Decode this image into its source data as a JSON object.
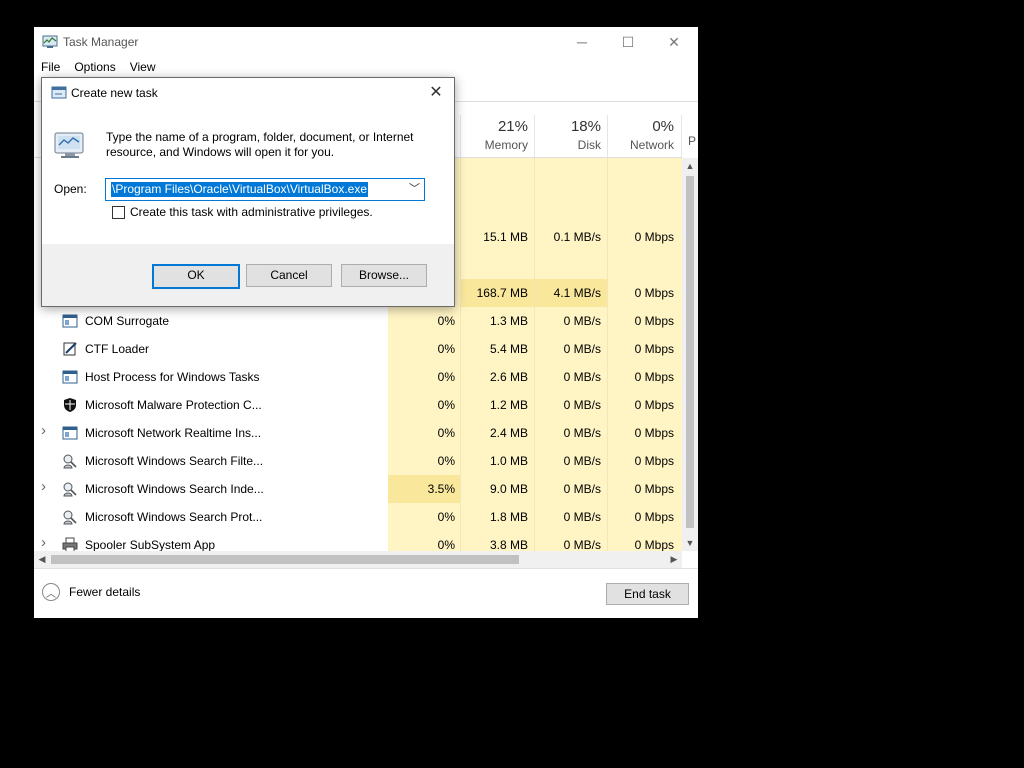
{
  "window": {
    "title": "Task Manager",
    "controls": {
      "minimize": "─",
      "maximize": "☐",
      "close": "✕"
    }
  },
  "menu": [
    "File",
    "Options",
    "View"
  ],
  "columns": [
    {
      "pct": "21%",
      "label": "Memory"
    },
    {
      "pct": "18%",
      "label": "Disk"
    },
    {
      "pct": "0%",
      "label": "Network"
    }
  ],
  "partial_header": {
    "p": "P"
  },
  "processes": [
    {
      "expand": "",
      "icon": "none",
      "name": "",
      "cpu": "",
      "mem": "",
      "disk": "",
      "net": ""
    },
    {
      "expand": "",
      "icon": "none",
      "name": "",
      "cpu": "",
      "mem": "15.1 MB",
      "disk": "0.1 MB/s",
      "net": "0 Mbps"
    },
    {
      "expand": "",
      "icon": "none",
      "name": "",
      "cpu": "",
      "mem": "",
      "disk": "",
      "net": ""
    },
    {
      "expand": "",
      "icon": "none",
      "name": "",
      "cpu": "",
      "mem": "168.7 MB",
      "disk": "4.1 MB/s",
      "net": "0 Mbps"
    },
    {
      "expand": "",
      "icon": "app-window-icon",
      "name": "COM Surrogate",
      "cpu": "0%",
      "mem": "1.3 MB",
      "disk": "0 MB/s",
      "net": "0 Mbps"
    },
    {
      "expand": "",
      "icon": "ctf-loader-icon",
      "name": "CTF Loader",
      "cpu": "0%",
      "mem": "5.4 MB",
      "disk": "0 MB/s",
      "net": "0 Mbps"
    },
    {
      "expand": "",
      "icon": "app-window-icon",
      "name": "Host Process for Windows Tasks",
      "cpu": "0%",
      "mem": "2.6 MB",
      "disk": "0 MB/s",
      "net": "0 Mbps"
    },
    {
      "expand": "",
      "icon": "shield-icon",
      "name": "Microsoft Malware Protection C...",
      "cpu": "0%",
      "mem": "1.2 MB",
      "disk": "0 MB/s",
      "net": "0 Mbps"
    },
    {
      "expand": ">",
      "icon": "app-window-icon",
      "name": "Microsoft Network Realtime Ins...",
      "cpu": "0%",
      "mem": "2.4 MB",
      "disk": "0 MB/s",
      "net": "0 Mbps"
    },
    {
      "expand": "",
      "icon": "search-person-icon",
      "name": "Microsoft Windows Search Filte...",
      "cpu": "0%",
      "mem": "1.0 MB",
      "disk": "0 MB/s",
      "net": "0 Mbps"
    },
    {
      "expand": ">",
      "icon": "search-person-icon",
      "name": "Microsoft Windows Search Inde...",
      "cpu": "3.5%",
      "mem": "9.0 MB",
      "disk": "0 MB/s",
      "net": "0 Mbps"
    },
    {
      "expand": "",
      "icon": "search-person-icon",
      "name": "Microsoft Windows Search Prot...",
      "cpu": "0%",
      "mem": "1.8 MB",
      "disk": "0 MB/s",
      "net": "0 Mbps"
    },
    {
      "expand": ">",
      "icon": "printer-icon",
      "name": "Spooler SubSystem App",
      "cpu": "0%",
      "mem": "3.8 MB",
      "disk": "0 MB/s",
      "net": "0 Mbps"
    }
  ],
  "footer": {
    "fewer_details": "Fewer details",
    "end_task": "End task"
  },
  "dialog": {
    "title": "Create new task",
    "message": "Type the name of a program, folder, document, or Internet resource, and Windows will open it for you.",
    "open_label": "Open:",
    "open_value": "\\Program Files\\Oracle\\VirtualBox\\VirtualBox.exe",
    "admin_label": "Create this task with administrative privileges.",
    "admin_checked": false,
    "ok": "OK",
    "cancel": "Cancel",
    "browse": "Browse...",
    "close": "✕"
  },
  "colors": {
    "heat_light": "#fff4c4",
    "heat_medium": "#f9e79b",
    "accent": "#0078d7"
  }
}
